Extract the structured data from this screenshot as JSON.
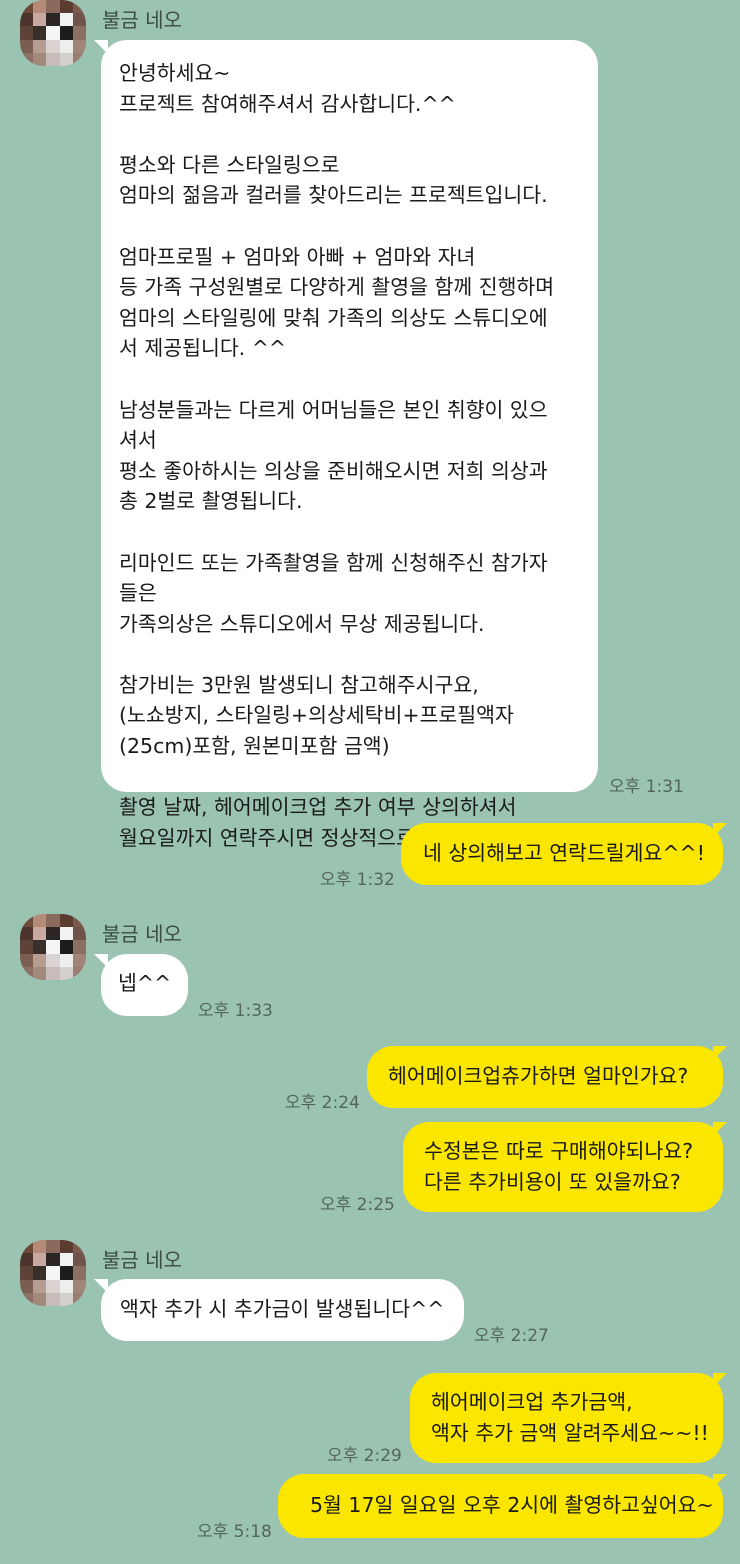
{
  "sender_name": "불금 네오",
  "colors": {
    "background": "#9bc3b2",
    "incoming_bubble": "#ffffff",
    "outgoing_bubble": "#fbe600"
  },
  "messages": [
    {
      "direction": "incoming",
      "lines": [
        "안녕하세요~",
        "프로젝트 참여해주셔서 감사합니다.^^",
        "",
        "평소와 다른 스타일링으로",
        "엄마의 젊음과 컬러를 찾아드리는 프로젝트입니다.",
        "",
        "엄마프로필 + 엄마와 아빠 + 엄마와 자녀",
        "등 가족 구성원별로 다양하게 촬영을 함께 진행하며",
        "엄마의 스타일링에 맞춰 가족의 의상도 스튜디오에",
        "서 제공됩니다. ^^",
        "",
        "남성분들과는 다르게 어머님들은 본인 취향이 있으",
        "셔서",
        "평소 좋아하시는 의상을 준비해오시면 저희 의상과",
        "총 2벌로 촬영됩니다.",
        "",
        "리마인드 또는 가족촬영을 함께 신청해주신 참가자",
        "들은",
        "가족의상은 스튜디오에서 무상 제공됩니다.",
        "",
        "참가비는 3만원 발생되니 참고해주시구요,",
        "(노쇼방지, 스타일링+의상세탁비+프로필액자",
        "(25cm)포함, 원본미포함 금액)",
        "",
        "촬영 날짜, 헤어메이크업 추가 여부 상의하셔서",
        "월요일까지 연락주시면 정상적으로 진행되십니다^^"
      ],
      "time": "오후 1:31"
    },
    {
      "direction": "outgoing",
      "lines": [
        "네 상의해보고 연락드릴게요^^!"
      ],
      "time": "오후 1:32"
    },
    {
      "direction": "incoming",
      "lines": [
        "넵^^"
      ],
      "time": "오후 1:33"
    },
    {
      "direction": "outgoing",
      "lines": [
        "헤어메이크업츄가하면 얼마인가요?"
      ],
      "time": "오후 2:24"
    },
    {
      "direction": "outgoing",
      "lines": [
        "수정본은 따로 구매해야되나요?",
        "다른 추가비용이 또 있을까요?"
      ],
      "time": "오후 2:25"
    },
    {
      "direction": "incoming",
      "lines": [
        "액자 추가 시 추가금이 발생됩니다^^"
      ],
      "time": "오후 2:27"
    },
    {
      "direction": "outgoing",
      "lines": [
        "헤어메이크업 추가금액,",
        "액자 추가 금액 알려주세요~~!!"
      ],
      "time": "오후 2:29"
    },
    {
      "direction": "outgoing",
      "lines": [
        "5월 17일 일요일 오후 2시에 촬영하고싶어요~"
      ],
      "time": "오후 5:18"
    }
  ]
}
